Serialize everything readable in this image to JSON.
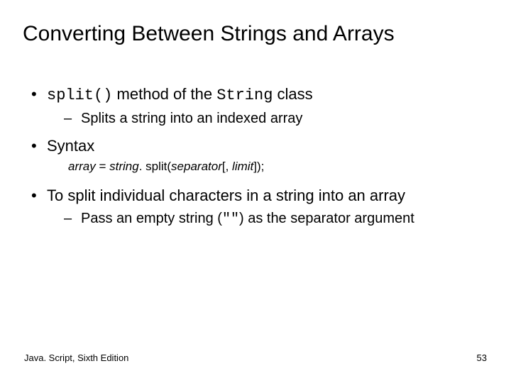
{
  "title": "Converting Between Strings and Arrays",
  "bullet1": {
    "code1": "split()",
    "mid1": " method of the ",
    "code2": "String",
    "tail": " class",
    "sub": "Splits a string into an indexed array"
  },
  "bullet2": {
    "label": "Syntax",
    "syntax": {
      "array": "array",
      "eq": " = ",
      "string": "string",
      "dot": ". ",
      "split": "split(",
      "sep": "separator",
      "brL": "[, ",
      "limit": "limit",
      "brR": "]);"
    }
  },
  "bullet3": {
    "text": "To split individual characters in a string into an array",
    "sub_pre": "Pass an empty string (",
    "sub_code": "\"\"",
    "sub_post": ") as the separator argument"
  },
  "footer": {
    "left": "Java. Script, Sixth Edition",
    "right": "53"
  }
}
